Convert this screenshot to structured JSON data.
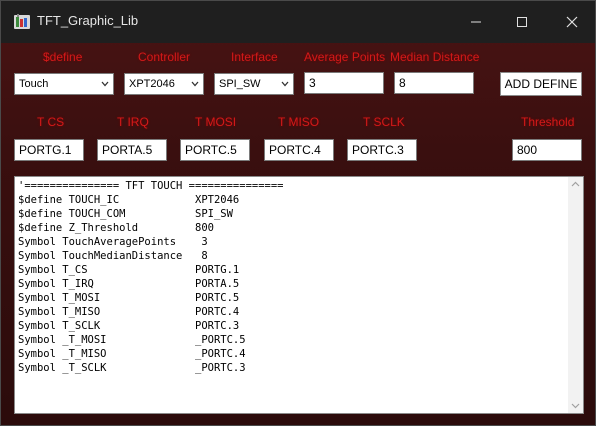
{
  "window": {
    "title": "TFT_Graphic_Lib",
    "icon": "app-icon"
  },
  "labels": {
    "define": "$define",
    "controller": "Controller",
    "interface": "Interface",
    "average_points": "Average Points",
    "median_distance": "Median Distance",
    "t_cs": "T CS",
    "t_irq": "T IRQ",
    "t_mosi": "T MOSI",
    "t_miso": "T MISO",
    "t_sclk": "T SCLK",
    "threshold": "Threshold"
  },
  "selects": {
    "define": "Touch",
    "controller": "XPT2046",
    "interface": "SPI_SW"
  },
  "fields": {
    "average_points": "3",
    "median_distance": "8",
    "t_cs": "PORTG.1",
    "t_irq": "PORTA.5",
    "t_mosi": "PORTC.5",
    "t_miso": "PORTC.4",
    "t_sclk": "PORTC.3",
    "threshold": "800"
  },
  "buttons": {
    "add_define": "ADD DEFINE"
  },
  "output": {
    "lines": [
      "'=============== TFT TOUCH ===============",
      "$define TOUCH_IC            XPT2046",
      "$define TOUCH_COM           SPI_SW",
      "$define Z_Threshold         800",
      "Symbol TouchAveragePoints    3",
      "Symbol TouchMedianDistance   8",
      "Symbol T_CS                 PORTG.1",
      "Symbol T_IRQ                PORTA.5",
      "Symbol T_MOSI               PORTC.5",
      "Symbol T_MISO               PORTC.4",
      "Symbol T_SCLK               PORTC.3",
      "Symbol _T_MOSI              _PORTC.5",
      "Symbol _T_MISO              _PORTC.4",
      "Symbol _T_SCLK              _PORTC.3"
    ]
  },
  "colors": {
    "label_red": "#d21a1a",
    "titlebar": "#1f1f1f",
    "background_top": "#4a1414",
    "background_bottom": "#2b0b0b"
  }
}
